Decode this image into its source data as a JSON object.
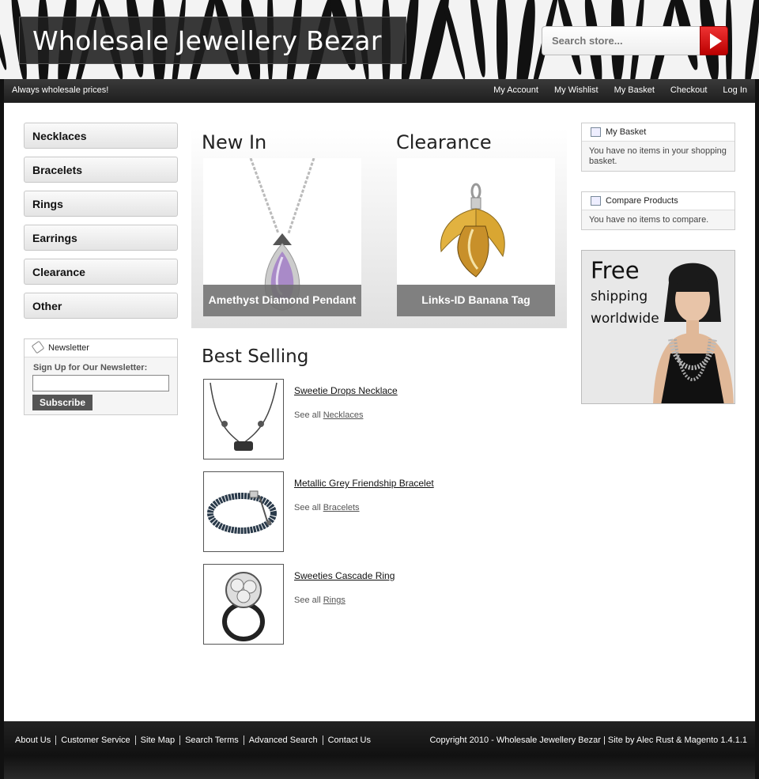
{
  "header": {
    "logo": "Wholesale Jewellery Bezar",
    "search_placeholder": "Search store..."
  },
  "topbar": {
    "tagline": "Always wholesale prices!",
    "links": [
      "My Account",
      "My Wishlist",
      "My Basket",
      "Checkout",
      "Log In"
    ]
  },
  "sidebar": {
    "categories": [
      "Necklaces",
      "Bracelets",
      "Rings",
      "Earrings",
      "Clearance",
      "Other"
    ]
  },
  "newsletter": {
    "title": "Newsletter",
    "label": "Sign Up for Our Newsletter:",
    "button": "Subscribe"
  },
  "featured": {
    "new_in": {
      "title": "New In",
      "caption": "Amethyst Diamond Pendant"
    },
    "clearance": {
      "title": "Clearance",
      "caption": "Links-ID Banana Tag"
    }
  },
  "best_selling": {
    "title": "Best Selling",
    "see_all_prefix": "See all",
    "items": [
      {
        "name": "Sweetie Drops Necklace",
        "category": "Necklaces"
      },
      {
        "name": "Metallic Grey Friendship Bracelet",
        "category": "Bracelets"
      },
      {
        "name": "Sweeties Cascade Ring",
        "category": "Rings"
      }
    ]
  },
  "basket_box": {
    "title": "My Basket",
    "text": "You have no items in your shopping basket."
  },
  "compare_box": {
    "title": "Compare Products",
    "text": "You have no items to compare."
  },
  "promo": {
    "line1": "Free",
    "line2": "shipping",
    "line3": "worldwide"
  },
  "footer": {
    "links": [
      "About Us",
      "Customer Service",
      "Site Map",
      "Search Terms",
      "Advanced Search",
      "Contact Us"
    ],
    "copyright": "Copyright 2010 - Wholesale Jewellery Bezar | Site by Alec Rust & Magento 1.4.1.1"
  }
}
